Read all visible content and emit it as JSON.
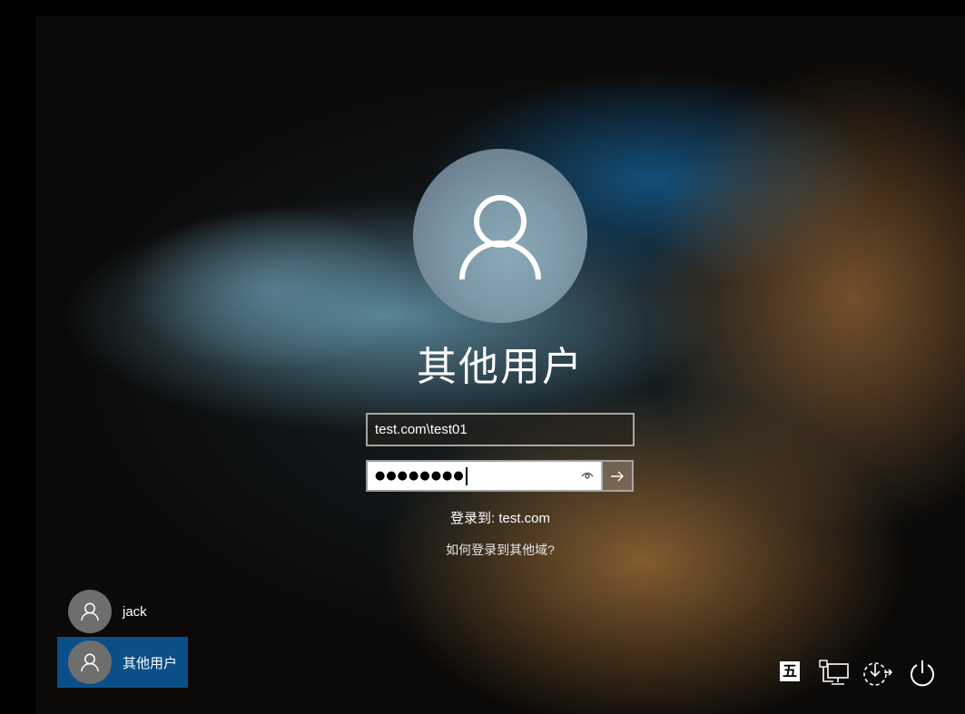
{
  "login": {
    "display_name": "其他用户",
    "username_value": "test.com\\test01",
    "password_mask": "●●●●●●●●",
    "sign_in_to": "登录到: test.com",
    "other_domain_link": "如何登录到其他域?"
  },
  "user_list": [
    {
      "name": "jack",
      "selected": false
    },
    {
      "name": "其他用户",
      "selected": true
    }
  ],
  "corner": {
    "ime_label": "五",
    "icons": [
      "ime-indicator-icon",
      "network-icon",
      "accessibility-icon",
      "power-icon"
    ]
  },
  "colors": {
    "selected_user_bg": "#0b4f89",
    "avatar_gray": "#6e6e6e"
  }
}
